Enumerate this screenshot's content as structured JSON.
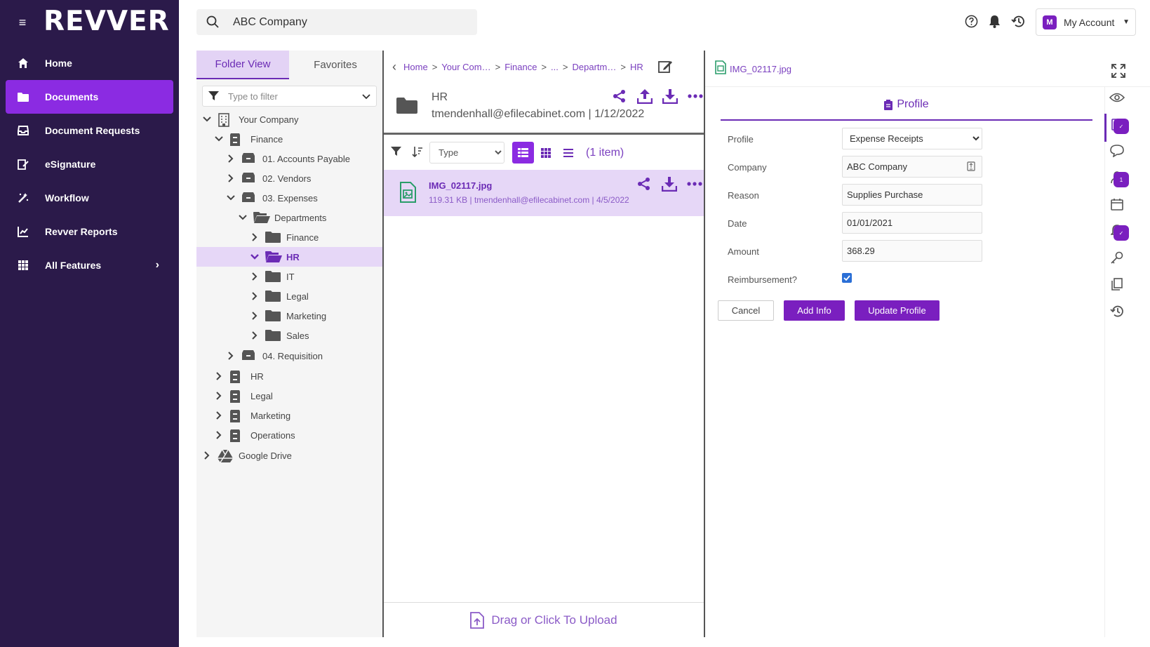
{
  "app": {
    "logo": "REVVER"
  },
  "sidebar": {
    "items": [
      {
        "label": "Home",
        "icon": "home-icon"
      },
      {
        "label": "Documents",
        "icon": "folder-icon",
        "active": true
      },
      {
        "label": "Document Requests",
        "icon": "inbox-icon"
      },
      {
        "label": "eSignature",
        "icon": "signature-icon"
      },
      {
        "label": "Workflow",
        "icon": "workflow-icon"
      },
      {
        "label": "Revver Reports",
        "icon": "chart-icon"
      },
      {
        "label": "All Features",
        "icon": "grid-icon"
      }
    ]
  },
  "topbar": {
    "search_value": "ABC Company",
    "account_badge": "M",
    "account_label": "My Account"
  },
  "folder_panel": {
    "tabs": [
      "Folder View",
      "Favorites"
    ],
    "filter_placeholder": "Type to filter",
    "tree": [
      {
        "label": "Your Company"
      },
      {
        "label": "Finance"
      },
      {
        "label": "01. Accounts Payable"
      },
      {
        "label": "02. Vendors"
      },
      {
        "label": "03. Expenses"
      },
      {
        "label": "Departments"
      },
      {
        "label": "Finance"
      },
      {
        "label": "HR"
      },
      {
        "label": "IT"
      },
      {
        "label": "Legal"
      },
      {
        "label": "Marketing"
      },
      {
        "label": "Sales"
      },
      {
        "label": "04. Requisition"
      },
      {
        "label": "HR"
      },
      {
        "label": "Legal"
      },
      {
        "label": "Marketing"
      },
      {
        "label": "Operations"
      },
      {
        "label": "Google Drive"
      }
    ]
  },
  "middle": {
    "breadcrumbs": [
      "Home",
      "Your Com…",
      "Finance",
      "...",
      "Departm…",
      "HR"
    ],
    "folder_name": "HR",
    "folder_meta": "tmendenhall@efilecabinet.com | 1/12/2022",
    "sort_type": "Type",
    "item_count": "(1 item)",
    "file": {
      "name": "IMG_02117.jpg",
      "meta": "119.31 KB | tmendenhall@efilecabinet.com | 4/5/2022"
    },
    "upload_label": "Drag or Click To Upload"
  },
  "right": {
    "file_name": "IMG_02117.jpg",
    "tab_label": "Profile",
    "form": {
      "profile_label": "Profile",
      "profile_value": "Expense Receipts",
      "company_label": "Company",
      "company_value": "ABC Company",
      "reason_label": "Reason",
      "reason_value": "Supplies Purchase",
      "date_label": "Date",
      "date_value": "01/01/2021",
      "amount_label": "Amount",
      "amount_value": "368.29",
      "reimbursement_label": "Reimbursement?",
      "reimbursement_checked": true
    },
    "buttons": {
      "cancel": "Cancel",
      "add_info": "Add Info",
      "update": "Update Profile"
    },
    "rail_badge": "1"
  },
  "colors": {
    "sidebar_bg": "#2b1a4a",
    "accent": "#8b2be2",
    "accent_dark": "#7a1fbf",
    "selection": "#e6d7f7"
  }
}
